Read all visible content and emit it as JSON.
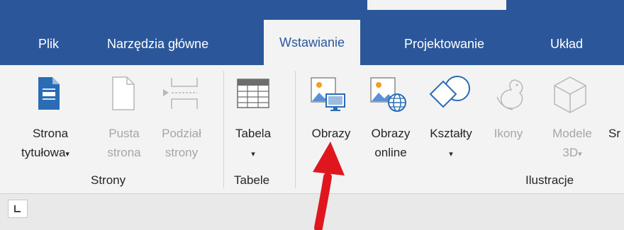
{
  "tabs": [
    "Plik",
    "Narzędzia główne",
    "Wstawianie",
    "Projektowanie",
    "Układ"
  ],
  "groups": {
    "strony": {
      "label": "Strony",
      "items": [
        {
          "line1": "Strona",
          "line2": "tytułowa",
          "caret": "▾"
        },
        {
          "line1": "Pusta",
          "line2": "strona"
        },
        {
          "line1": "Podział",
          "line2": "strony"
        }
      ]
    },
    "tabele": {
      "label": "Tabele",
      "items": [
        {
          "line1": "Tabela",
          "caret": "▾"
        }
      ]
    },
    "ilustracje": {
      "label": "Ilustracje",
      "items": [
        {
          "line1": "Obrazy"
        },
        {
          "line1": "Obrazy",
          "line2": "online"
        },
        {
          "line1": "Kształty",
          "caret": "▾"
        },
        {
          "line1": "Ikony"
        },
        {
          "line1": "Modele",
          "line2": "3D",
          "caret": "▾"
        },
        {
          "line1": "Sr"
        }
      ]
    }
  },
  "colors": {
    "ribbon_blue": "#2b579a",
    "ribbon_bg": "#f3f3f3",
    "accent_blue": "#2b579a",
    "annotation_red": "#e0161f"
  },
  "icons": [
    "cover-page-icon",
    "blank-page-icon",
    "page-break-icon",
    "table-icon",
    "pictures-icon",
    "online-pictures-icon",
    "shapes-icon",
    "icons-icon",
    "3d-models-icon",
    "dialog-launcher-icon"
  ]
}
